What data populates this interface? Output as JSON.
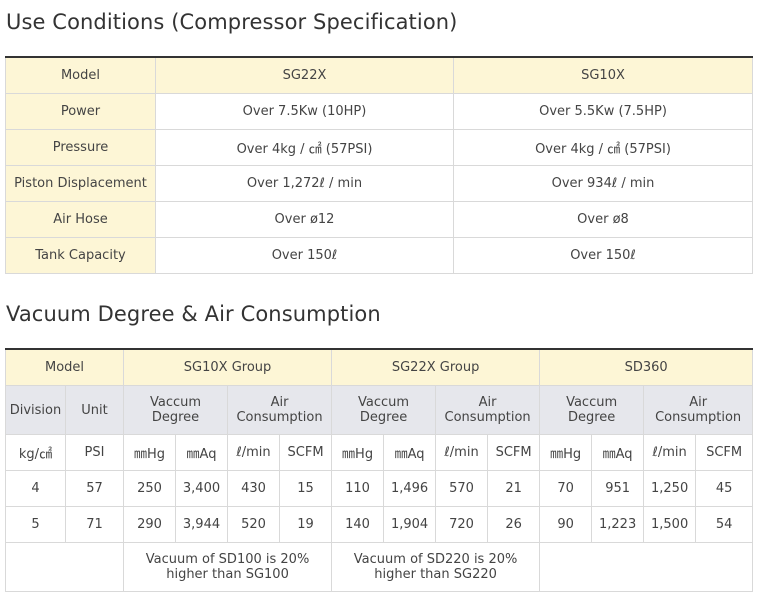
{
  "spec": {
    "title": "Use Conditions (Compressor Specification)",
    "header": [
      "Model",
      "SG22X",
      "SG10X"
    ],
    "rows": [
      {
        "label": "Power",
        "sg22x": "Over 7.5Kw (10HP)",
        "sg10x": "Over 5.5Kw (7.5HP)"
      },
      {
        "label": "Pressure",
        "sg22x": "Over 4kg / ㎠ (57PSI)",
        "sg10x": "Over 4kg / ㎠ (57PSI)"
      },
      {
        "label": "Piston Displacement",
        "sg22x": "Over 1,272ℓ / min",
        "sg10x": "Over 934ℓ / min"
      },
      {
        "label": "Air Hose",
        "sg22x": "Over ø12",
        "sg10x": "Over ø8"
      },
      {
        "label": "Tank Capacity",
        "sg22x": "Over 150ℓ",
        "sg10x": "Over 150ℓ"
      }
    ]
  },
  "vacuum": {
    "title": "Vacuum Degree & Air Consumption",
    "model_label": "Model",
    "groups": [
      "SG10X Group",
      "SG22X Group",
      "SD360"
    ],
    "division_label": "Division",
    "unit_label": "Unit",
    "vaccum_degree_label": "Vaccum Degree",
    "air_consumption_label": "Air Consumption",
    "unit_row": [
      "kg/㎠",
      "PSI",
      "㎜Hg",
      "㎜Aq",
      "ℓ/min",
      "SCFM",
      "㎜Hg",
      "㎜Aq",
      "ℓ/min",
      "SCFM",
      "㎜Hg",
      "㎜Aq",
      "ℓ/min",
      "SCFM"
    ],
    "data_rows": [
      [
        "4",
        "57",
        "250",
        "3,400",
        "430",
        "15",
        "110",
        "1,496",
        "570",
        "21",
        "70",
        "951",
        "1,250",
        "45"
      ],
      [
        "5",
        "71",
        "290",
        "3,944",
        "520",
        "19",
        "140",
        "1,904",
        "720",
        "26",
        "90",
        "1,223",
        "1,500",
        "54"
      ]
    ],
    "notes": [
      "Vacuum of SD100 is 20% higher than SG100",
      "Vacuum of SD220 is 20% higher than SG220"
    ]
  }
}
